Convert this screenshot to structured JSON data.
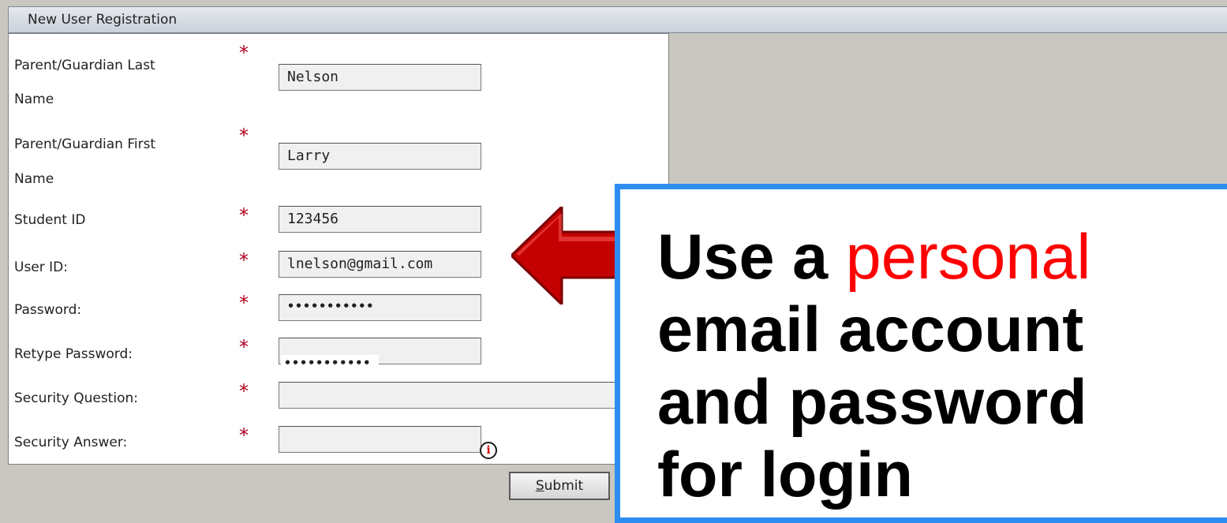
{
  "panel": {
    "title": "New User Registration"
  },
  "fields": {
    "last_name": {
      "label_line1": "Parent/Guardian Last",
      "label_line2": "Name",
      "value": "Nelson"
    },
    "first_name": {
      "label_line1": "Parent/Guardian First",
      "label_line2": "Name",
      "value": "Larry"
    },
    "student_id": {
      "label": "Student ID",
      "value": "123456"
    },
    "user_id": {
      "label": "User ID:",
      "value": "lnelson@gmail.com"
    },
    "password": {
      "label": "Password:",
      "value": "•••••••••••"
    },
    "retype_password": {
      "label": "Retype Password:",
      "value": "•••••••••••"
    },
    "security_question": {
      "label": "Security Question:",
      "value": ""
    },
    "security_answer": {
      "label": "Security Answer:",
      "value": ""
    }
  },
  "required_marker": "*",
  "submit": {
    "accel": "S",
    "rest": "ubmit"
  },
  "callout": {
    "line1_prefix": "Use a ",
    "line1_highlight": "personal",
    "line2": "email account",
    "line3": "and password",
    "line4": "for login"
  },
  "colors": {
    "callout_border": "#2f8cf0",
    "highlight": "#ff0000",
    "arrow": "#c40000",
    "required": "#b00020"
  },
  "icons": {
    "info": "info-icon",
    "arrow": "left-arrow-icon"
  }
}
